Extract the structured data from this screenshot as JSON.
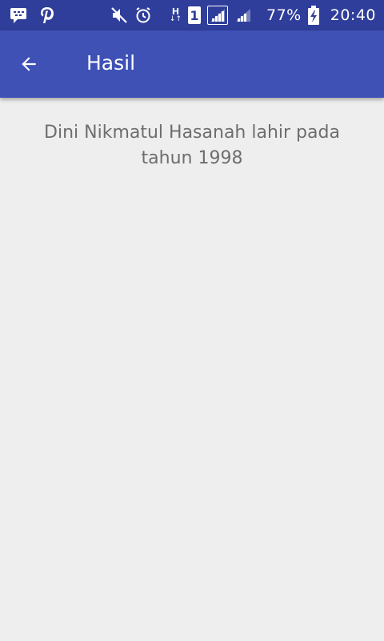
{
  "status_bar": {
    "battery_percent": "77%",
    "time": "20:40",
    "network_type": "H",
    "sim_slot": "1",
    "icons": [
      "bbm-icon",
      "pinterest-icon",
      "mute-icon",
      "alarm-icon",
      "network-h-icon",
      "sim-1-icon",
      "signal-icon",
      "signal-icon",
      "battery-charging-icon"
    ]
  },
  "app_bar": {
    "title": "Hasil",
    "back_icon": "arrow-back-icon",
    "background_color": "#3f51b5"
  },
  "content": {
    "result_text": "Dini Nikmatul Hasanah lahir pada tahun 1998"
  },
  "colors": {
    "status_bar": "#2f3e9a",
    "background": "#eeeeee",
    "text": "#6e6e6e"
  }
}
